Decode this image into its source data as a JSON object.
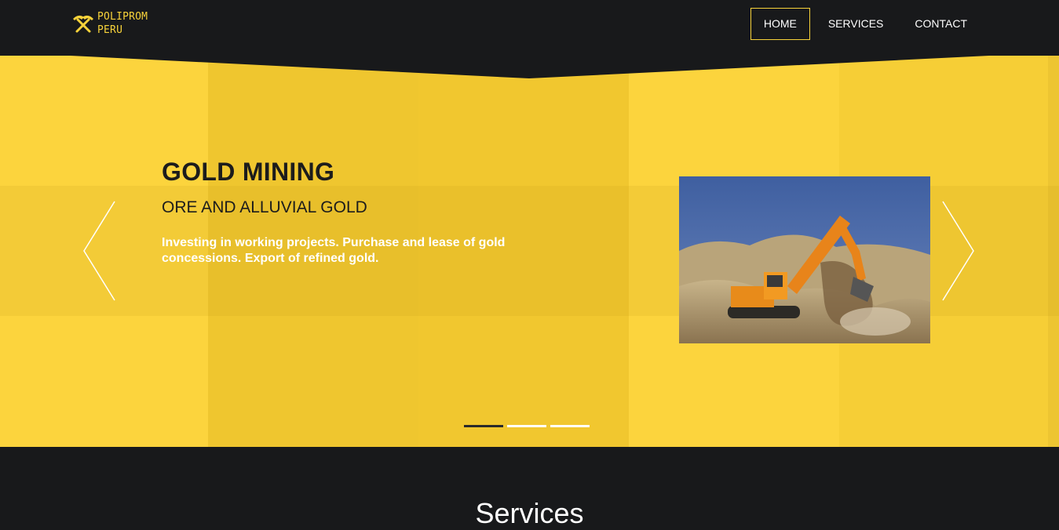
{
  "brand": {
    "line1": "POLIPROM",
    "line2": "PERU",
    "icon": "crossed-pickaxes-icon",
    "color": "#f7d23a"
  },
  "nav": {
    "items": [
      {
        "label": "HOME",
        "active": true
      },
      {
        "label": "SERVICES",
        "active": false
      },
      {
        "label": "CONTACT",
        "active": false
      }
    ]
  },
  "hero": {
    "background": "#fcd43d",
    "title": "GOLD MINING",
    "subtitle": "ORE AND ALLUVIAL GOLD",
    "text": "Investing in working projects. Purchase and lease of gold concessions. Export of refined gold.",
    "image": "excavator-photo",
    "prev_icon": "chevron-left-icon",
    "next_icon": "chevron-right-icon",
    "slide_count": 3,
    "active_slide": 1
  },
  "services": {
    "title": "Services"
  }
}
